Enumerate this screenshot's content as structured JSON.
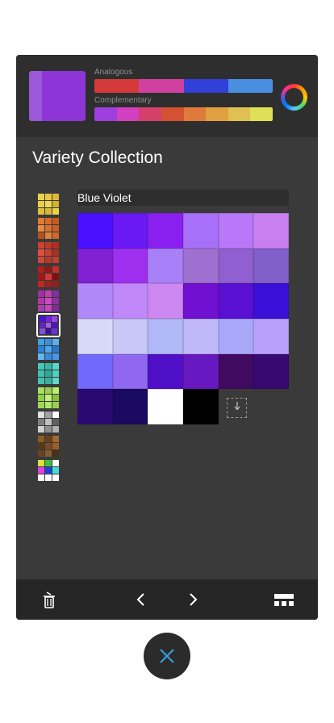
{
  "current_color": {
    "previous": "#9b59d9",
    "current": "#8e35d8"
  },
  "harmony": {
    "analogous_label": "Analogous",
    "complementary_label": "Complementary",
    "analogous": [
      "#d43a3a",
      "#d040a0",
      "#3040d8",
      "#4a8ee0"
    ],
    "complementary": [
      "#9e3fe0",
      "#d43fc0",
      "#d4406a",
      "#d45232",
      "#e07a3a",
      "#e0a040",
      "#e0c050",
      "#e0e058"
    ]
  },
  "collection_title": "Variety Collection",
  "palette_name": "Blue Violet",
  "palettes": [
    {
      "id": "yellow",
      "selected": false,
      "cells": [
        "#e8d448",
        "#e8c840",
        "#e0b838",
        "#e8d048",
        "#f0d850",
        "#d8b030",
        "#e0c040",
        "#d8b838",
        "#e8d448"
      ]
    },
    {
      "id": "orange",
      "selected": false,
      "cells": [
        "#e07a30",
        "#d86a28",
        "#c85a20",
        "#e88a40",
        "#d87030",
        "#c86020",
        "#b85018",
        "#e08038",
        "#d06828"
      ]
    },
    {
      "id": "red",
      "selected": false,
      "cells": [
        "#d04030",
        "#c03828",
        "#b03020",
        "#e05040",
        "#c84030",
        "#a83020",
        "#d04838",
        "#b83828",
        "#c04030"
      ]
    },
    {
      "id": "crimson",
      "selected": false,
      "cells": [
        "#b02020",
        "#901818",
        "#c03030",
        "#a01818",
        "#d03838",
        "#801010",
        "#c02828",
        "#a02020",
        "#902020"
      ]
    },
    {
      "id": "magenta",
      "selected": false,
      "cells": [
        "#a030a0",
        "#c040b0",
        "#8030a0",
        "#b038a8",
        "#d048c0",
        "#9030a0",
        "#a840b0",
        "#c048b8",
        "#8828a0"
      ]
    },
    {
      "id": "blue-violet",
      "selected": true,
      "cells": [
        "#4a10e0",
        "#7a20e8",
        "#9a40e8",
        "#6a20d0",
        "#a060f0",
        "#5010c8",
        "#8050e0",
        "#3a10a0",
        "#6a30d8"
      ]
    },
    {
      "id": "blue",
      "selected": false,
      "cells": [
        "#40a0e8",
        "#3890e0",
        "#5ab0f0",
        "#3080d8",
        "#48a8e8",
        "#2878d0",
        "#60b8f0",
        "#3888e0",
        "#4898e8"
      ]
    },
    {
      "id": "teal",
      "selected": false,
      "cells": [
        "#48c8b8",
        "#38b8a8",
        "#58d8c8",
        "#40c0b0",
        "#30a898",
        "#50d0c0",
        "#48c0b0",
        "#38b0a0",
        "#60d8c8"
      ]
    },
    {
      "id": "green",
      "selected": false,
      "cells": [
        "#a8e060",
        "#98d050",
        "#b8f070",
        "#90d048",
        "#c0f078",
        "#88c040",
        "#a0d858",
        "#b0e868",
        "#98d050"
      ]
    },
    {
      "id": "gray",
      "selected": false,
      "cells": [
        "#e0e0e0",
        "#a0a0a0",
        "#ffffff",
        "#808080",
        "#c0c0c0",
        "#606060",
        "#d0d0d0",
        "#909090",
        "#b0b0b0"
      ]
    },
    {
      "id": "brown",
      "selected": false,
      "cells": [
        "#8a5a28",
        "#6a4018",
        "#a06830",
        "#5a3818",
        "#7a4a20",
        "#9a6028",
        "#6a4420",
        "#806030",
        "#4a3018"
      ]
    },
    {
      "id": "mixed",
      "selected": false,
      "cells": [
        "#e0e040",
        "#40c040",
        "#ffffff",
        "#e040e0",
        "#2040e0",
        "#40e0e0",
        "#ffffff",
        "#ffffff",
        "#ffffff"
      ]
    }
  ],
  "swatches": [
    "#4a10ff",
    "#6a18f4",
    "#8a20f0",
    "#a870f8",
    "#b878f8",
    "#c880f0",
    "#8020d0",
    "#a030f0",
    "#a880f8",
    "#a070d0",
    "#9060d0",
    "#8060c8",
    "#b088f8",
    "#c088f8",
    "#cc88f0",
    "#7010d0",
    "#5a10d0",
    "#3a10d8",
    "#d8d8f8",
    "#c8c8f8",
    "#b0b8f8",
    "#c0b8f8",
    "#a8a8f8",
    "#b8a0f8",
    "#7068f8",
    "#9068f0",
    "#5010c8",
    "#6818c0",
    "#400a60",
    "#360a70",
    "#2a0a70",
    "#1a0a60",
    "#ffffff",
    "#000000",
    "",
    ""
  ],
  "toolbar": {
    "delete_icon": "trash-icon",
    "prev_icon": "chevron-left-icon",
    "next_icon": "chevron-right-icon",
    "layout_icon": "grid-layout-icon"
  },
  "close_icon": "close-icon",
  "add_swatch_icon": "download-arrow-icon"
}
